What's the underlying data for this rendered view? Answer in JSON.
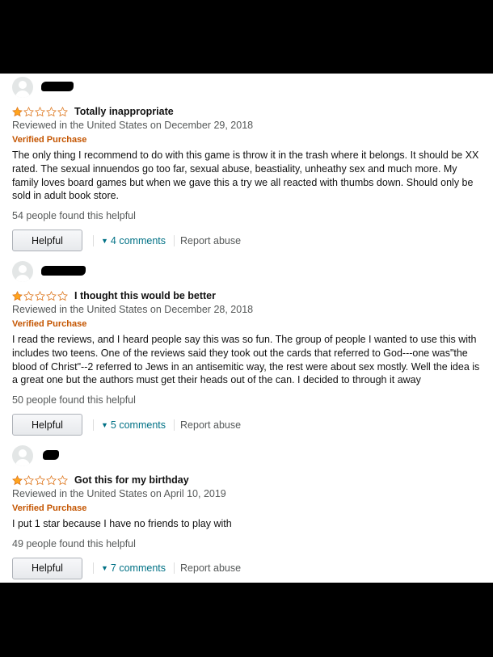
{
  "reviews": [
    {
      "rating_out_of_5": 1,
      "title": "Totally inappropriate",
      "meta": "Reviewed in the United States on December 29, 2018",
      "verified": "Verified Purchase",
      "body": "The only thing I recommend to do with this game is throw it in the trash where it belongs. It should be XX rated. The sexual innuendos go too far, sexual abuse, beastiality, unheathy sex and much more. My family loves board games but when we gave this a try we all reacted with thumbs down. Should only be sold in adult book store.",
      "found_helpful": "54 people found this helpful",
      "helpful_label": "Helpful",
      "comments_label": "4 comments",
      "report_label": "Report abuse"
    },
    {
      "rating_out_of_5": 1,
      "title": "I thought this would be better",
      "meta": "Reviewed in the United States on December 28, 2018",
      "verified": "Verified Purchase",
      "body": "I read the reviews, and I heard people say this was so fun. The group of people I wanted to use this with includes two teens. One of the reviews said they took out the cards that referred to God---one was\"the blood of Christ\"--2 referred to Jews in an antisemitic way, the rest were about sex mostly. Well the idea is a great one but the authors must get their heads out of the can. I decided to through it away",
      "found_helpful": "50 people found this helpful",
      "helpful_label": "Helpful",
      "comments_label": "5 comments",
      "report_label": "Report abuse"
    },
    {
      "rating_out_of_5": 1,
      "title": "Got this for my birthday",
      "meta": "Reviewed in the United States on April 10, 2019",
      "verified": "Verified Purchase",
      "body": "I put 1 star because I have no friends to play with",
      "found_helpful": "49 people found this helpful",
      "helpful_label": "Helpful",
      "comments_label": "7 comments",
      "report_label": "Report abuse"
    }
  ],
  "icons": {
    "avatar": "user-silhouette-icon",
    "star": "star-icon",
    "chevron": "chevron-down-icon"
  },
  "colors": {
    "star_fill": "#ffa41c",
    "star_outline": "#de7921",
    "verified": "#c45500",
    "link": "#007185",
    "muted": "#565959"
  }
}
